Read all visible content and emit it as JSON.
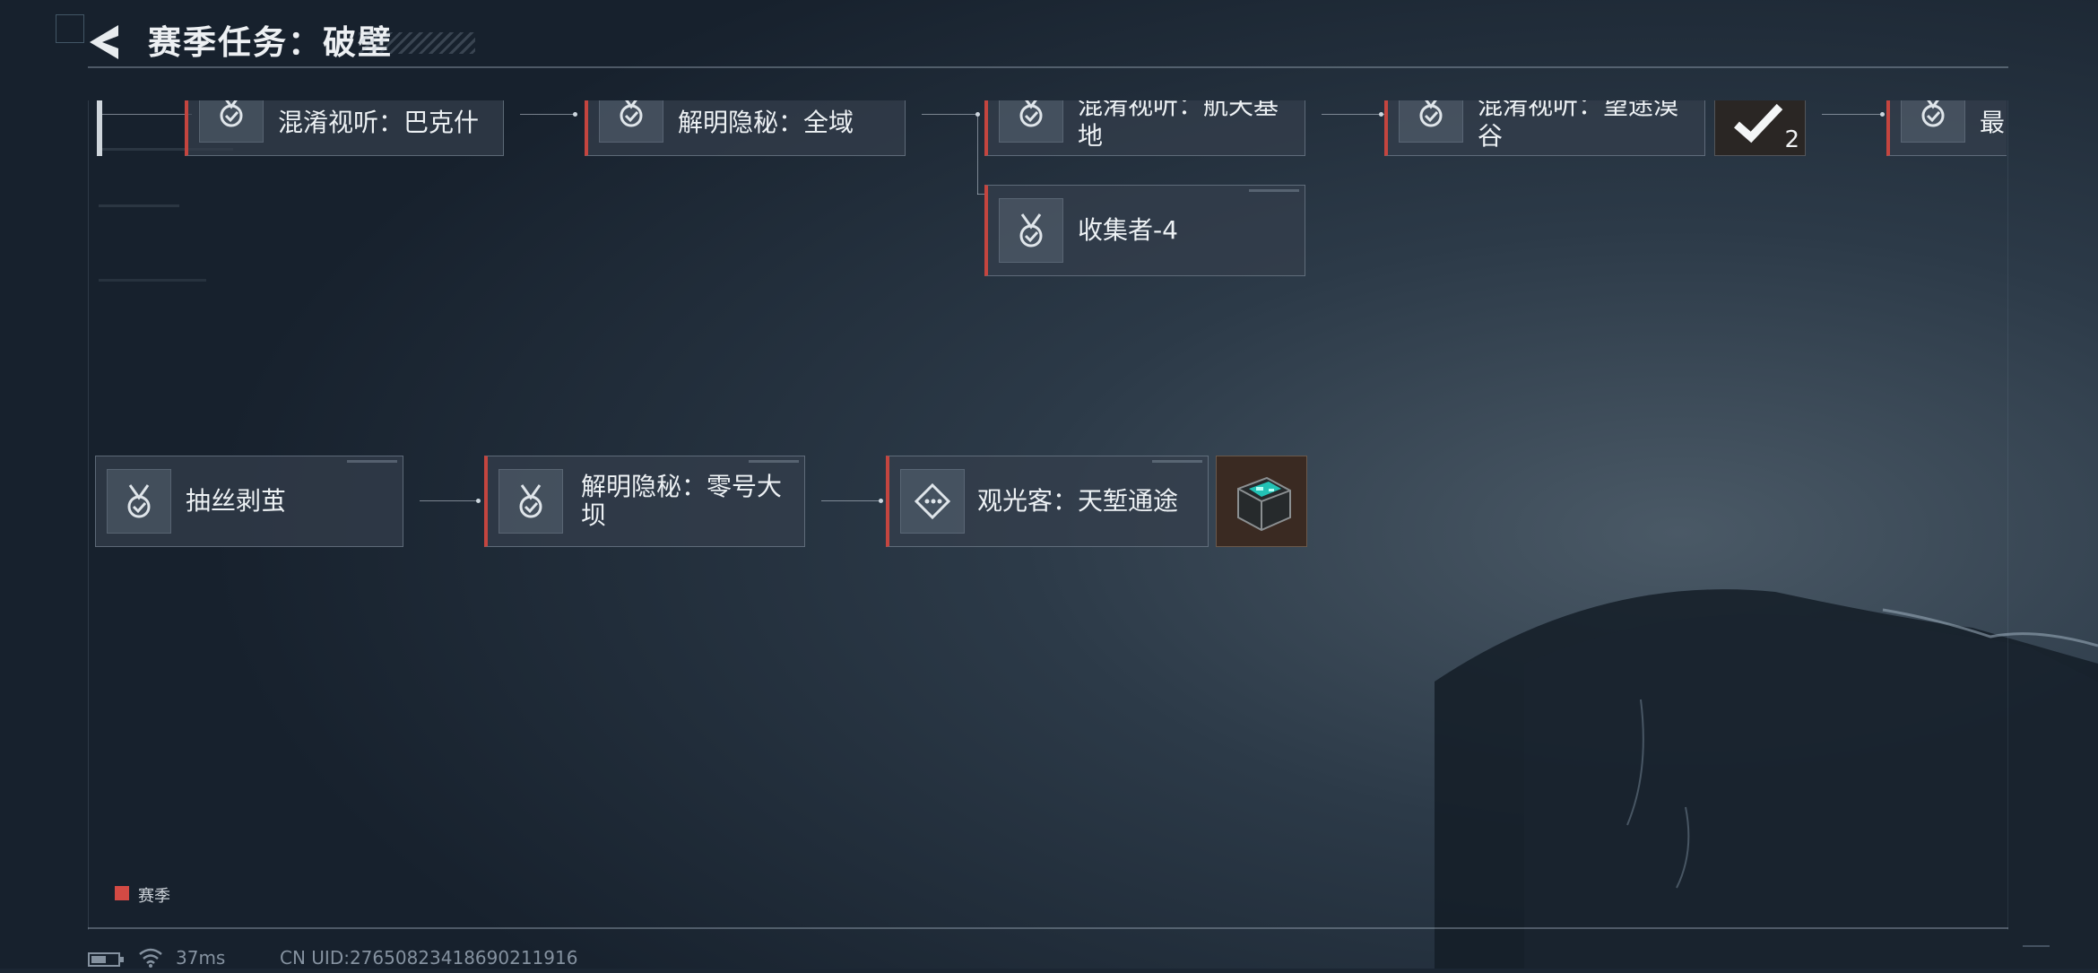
{
  "header": {
    "title": "赛季任务：破壁"
  },
  "colors": {
    "accent": "#c4453f",
    "legend_swatch": "#d34a44",
    "background": "#1b2633",
    "reward_bg": "#3a2a22"
  },
  "top_row": [
    {
      "label": "混淆视听：巴克什",
      "icon": "medal-check-icon"
    },
    {
      "label": "解明隐秘：全域",
      "icon": "medal-check-icon"
    },
    {
      "label": "混淆视听：航天基\n地",
      "icon": "medal-check-icon"
    },
    {
      "label": "混淆视听：望途漠\n谷",
      "icon": "medal-check-icon"
    },
    {
      "label": "最",
      "icon": "medal-check-icon"
    }
  ],
  "top_branch": {
    "label": "收集者-4",
    "icon": "medal-check-icon"
  },
  "top_reward": {
    "count": "2",
    "icon": "checkmark-icon"
  },
  "bottom_row": [
    {
      "label": "抽丝剥茧",
      "icon": "medal-check-icon"
    },
    {
      "label": "解明隐秘：零号大\n坝",
      "icon": "medal-check-icon"
    },
    {
      "label": "观光客：天堑通途",
      "icon": "diamond-dots-icon"
    }
  ],
  "bottom_reward": {
    "icon": "supply-crate-icon"
  },
  "legend": {
    "label": "赛季"
  },
  "status": {
    "latency": "37ms",
    "uid": "CN UID:276508234186902119​16"
  }
}
